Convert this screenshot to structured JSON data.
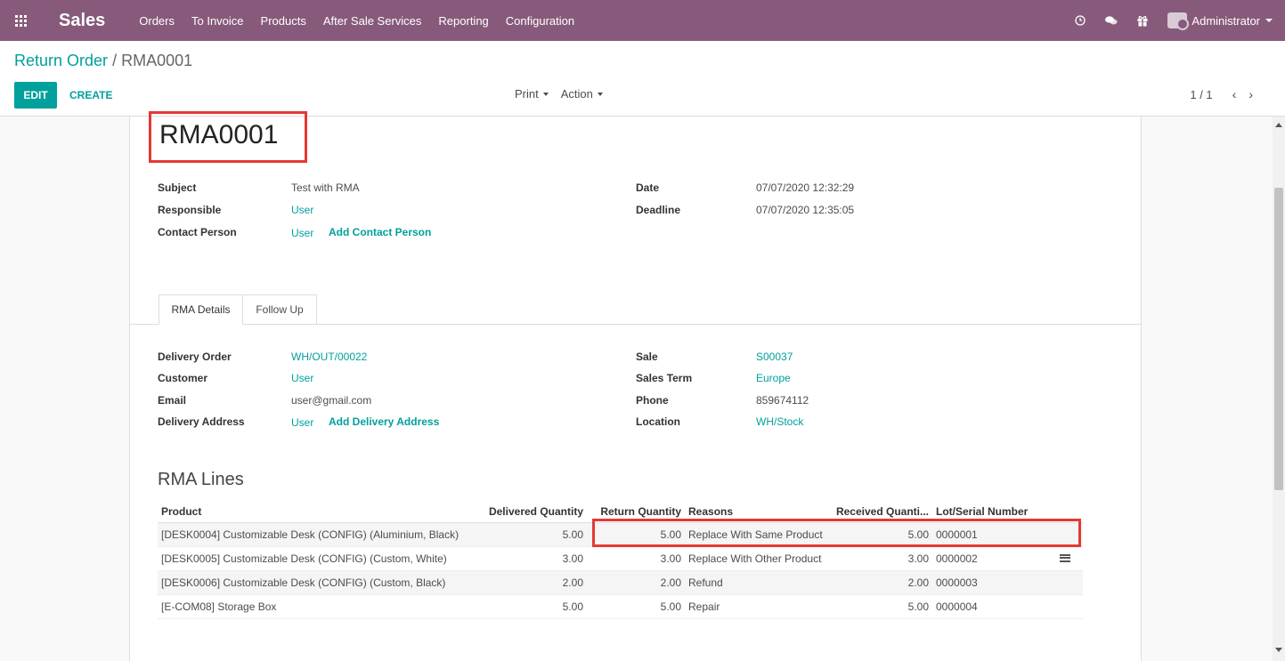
{
  "navbar": {
    "app_name": "Sales",
    "menu": [
      "Orders",
      "To Invoice",
      "Products",
      "After Sale Services",
      "Reporting",
      "Configuration"
    ],
    "icons": [
      "clock-icon",
      "chat-icon",
      "gift-icon"
    ],
    "user": "Administrator",
    "color": "#875A7B"
  },
  "control_panel": {
    "breadcrumb_parent": "Return Order",
    "breadcrumb_sep": "/",
    "breadcrumb_current": "RMA0001",
    "edit_label": "EDIT",
    "create_label": "CREATE",
    "print_label": "Print",
    "action_label": "Action",
    "pager": "1 / 1",
    "accent": "#00A09D"
  },
  "record": {
    "name": "RMA0001",
    "subject_label": "Subject",
    "subject": "Test with RMA",
    "responsible_label": "Responsible",
    "responsible": "User",
    "contact_label": "Contact Person",
    "contact": "User",
    "add_contact": "Add Contact Person",
    "date_label": "Date",
    "date": "07/07/2020 12:32:29",
    "deadline_label": "Deadline",
    "deadline": "07/07/2020 12:35:05"
  },
  "tabs": [
    "RMA Details",
    "Follow Up"
  ],
  "details": {
    "delivery_order_label": "Delivery Order",
    "delivery_order": "WH/OUT/00022",
    "customer_label": "Customer",
    "customer": "User",
    "email_label": "Email",
    "email": "user@gmail.com",
    "delivery_address_label": "Delivery Address",
    "delivery_address": "User",
    "add_delivery_address": "Add Delivery Address",
    "sale_label": "Sale",
    "sale": "S00037",
    "sales_term_label": "Sales Term",
    "sales_term": "Europe",
    "phone_label": "Phone",
    "phone": "859674112",
    "location_label": "Location",
    "location": "WH/Stock"
  },
  "rma_lines": {
    "title": "RMA Lines",
    "columns": [
      "Product",
      "Delivered Quantity",
      "Return Quantity",
      "Reasons",
      "Received Quanti...",
      "Lot/Serial Number"
    ],
    "rows": [
      [
        "[DESK0004] Customizable Desk (CONFIG) (Aluminium, Black)",
        "5.00",
        "5.00",
        "Replace With Same Product",
        "5.00",
        "0000001"
      ],
      [
        "[DESK0005] Customizable Desk (CONFIG) (Custom, White)",
        "3.00",
        "3.00",
        "Replace With Other Product",
        "3.00",
        "0000002"
      ],
      [
        "[DESK0006] Customizable Desk (CONFIG) (Custom, Black)",
        "2.00",
        "2.00",
        "Refund",
        "2.00",
        "0000003"
      ],
      [
        "[E-COM08] Storage Box",
        "5.00",
        "5.00",
        "Repair",
        "5.00",
        "0000004"
      ]
    ]
  },
  "highlight_color": "#e53935"
}
